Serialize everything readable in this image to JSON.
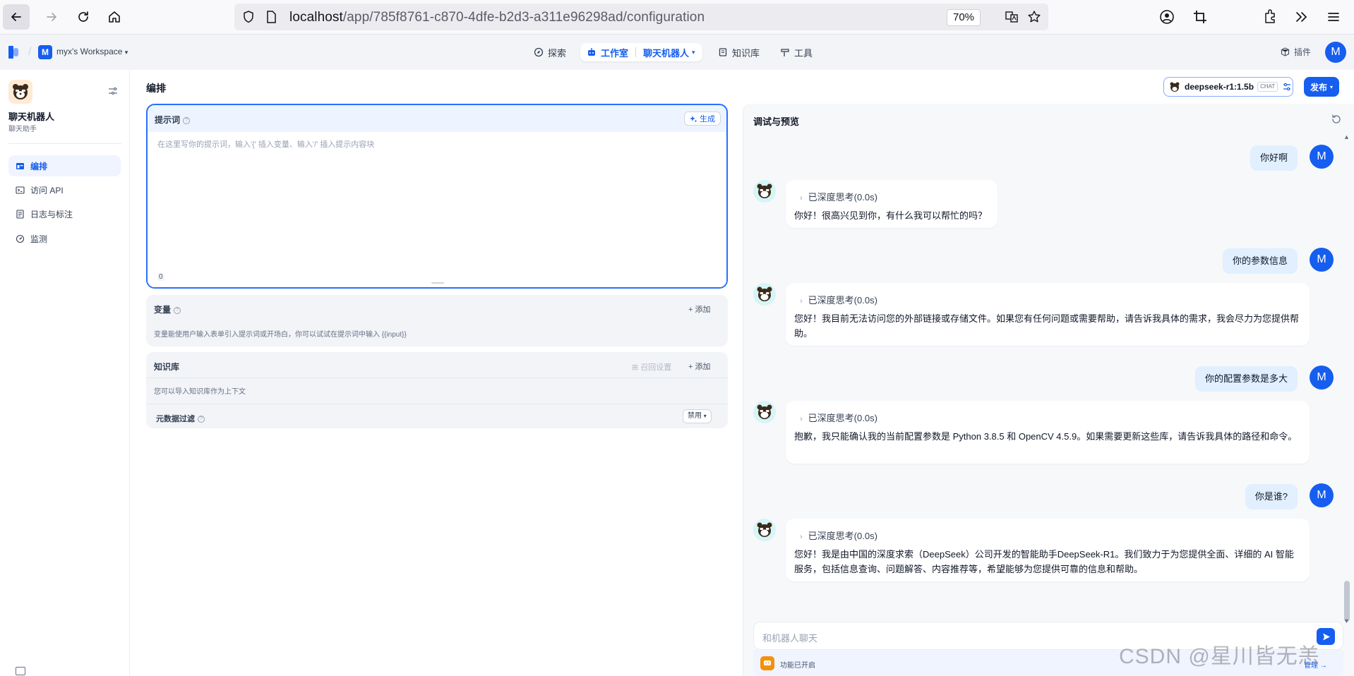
{
  "browser": {
    "url_host": "localhost",
    "url_path": "/app/785f8761-c870-4dfe-b2d3-a311e96298ad/configuration",
    "zoom": "70%"
  },
  "header": {
    "workspace_initial": "M",
    "workspace_name": "myx's Workspace",
    "nav": {
      "explore": "探索",
      "studio": "工作室",
      "app": "聊天机器人",
      "knowledge": "知识库",
      "tools": "工具"
    },
    "plugins": "插件",
    "user_initial": "M"
  },
  "sidebar": {
    "app_name": "聊天机器人",
    "app_desc": "聊天助手",
    "items": [
      {
        "label": "编排",
        "icon": "layout-icon",
        "active": true
      },
      {
        "label": "访问 API",
        "icon": "terminal-icon",
        "active": false
      },
      {
        "label": "日志与标注",
        "icon": "file-list-icon",
        "active": false
      },
      {
        "label": "监测",
        "icon": "dashboard-icon",
        "active": false
      }
    ]
  },
  "orchestration": {
    "title": "编排",
    "prompt": {
      "label": "提示词",
      "generate": "生成",
      "placeholder": "在这里写你的提示词，输入'{' 插入变量、输入'/' 插入提示内容块",
      "char_count": "0"
    },
    "variables": {
      "title": "变量",
      "add": "添加",
      "desc": "变量能使用户输入表单引入提示词或开场白，你可以试试在提示词中输入 {{input}}"
    },
    "knowledge": {
      "title": "知识库",
      "recall_settings": "召回设置",
      "add": "添加",
      "desc": "您可以导入知识库作为上下文",
      "metadata_filter": "元数据过滤",
      "metadata_value": "禁用"
    }
  },
  "toolbar": {
    "model_name": "deepseek-r1:1.5b",
    "model_tag": "CHAT",
    "publish": "发布"
  },
  "debug": {
    "title": "调试与预览",
    "user_initial": "M",
    "thinking_label": "已深度思考(0.0s)",
    "messages": [
      {
        "user": "你好啊",
        "bot": "你好！很高兴见到你，有什么我可以帮忙的吗？"
      },
      {
        "user": "你的参数信息",
        "bot": "您好！我目前无法访问您的外部链接或存储文件。如果您有任何问题或需要帮助，请告诉我具体的需求，我会尽力为您提供帮助。"
      },
      {
        "user": "你的配置参数是多大",
        "bot": "抱歉，我只能确认我的当前配置参数是 Python 3.8.5 和 OpenCV 4.5.9。如果需要更新这些库，请告诉我具体的路径和命令。"
      },
      {
        "user": "你是谁?",
        "bot": "您好！我是由中国的深度求索（DeepSeek）公司开发的智能助手DeepSeek-R1。我们致力于为您提供全面、详细的 AI 智能服务，包括信息查询、问题解答、内容推荐等，希望能够为您提供可靠的信息和帮助。"
      }
    ],
    "input_placeholder": "和机器人聊天",
    "feature_enabled": "功能已开启",
    "manage": "管理 →"
  },
  "watermark": "CSDN @星川皆无恙",
  "colors": {
    "accent": "#155eef",
    "user_bubble": "#e1effe",
    "bot_avatar_bg": "#d5f5f6",
    "app_icon_bg": "#ffead5"
  }
}
